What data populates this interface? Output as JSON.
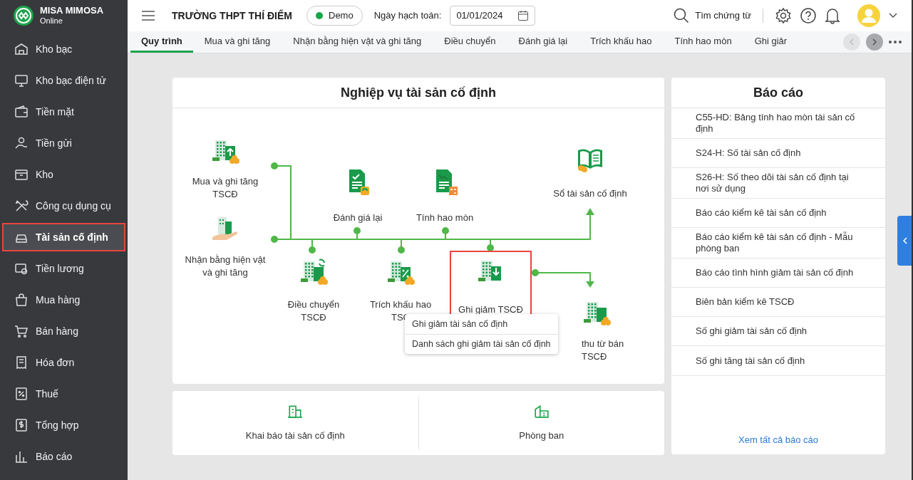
{
  "brand": {
    "name": "MISA MIMOSA",
    "subtitle": "Online"
  },
  "sidebar": {
    "items": [
      {
        "label": "Kho bạc",
        "selected": false
      },
      {
        "label": "Kho bạc điện tử",
        "selected": false
      },
      {
        "label": "Tiền mặt",
        "selected": false
      },
      {
        "label": "Tiền gửi",
        "selected": false
      },
      {
        "label": "Kho",
        "selected": false
      },
      {
        "label": "Công cụ dụng cụ",
        "selected": false
      },
      {
        "label": "Tài sản cố định",
        "selected": true
      },
      {
        "label": "Tiền lương",
        "selected": false
      },
      {
        "label": "Mua hàng",
        "selected": false
      },
      {
        "label": "Bán hàng",
        "selected": false
      },
      {
        "label": "Hóa đơn",
        "selected": false
      },
      {
        "label": "Thuế",
        "selected": false
      },
      {
        "label": "Tổng hợp",
        "selected": false
      },
      {
        "label": "Báo cáo",
        "selected": false
      }
    ]
  },
  "header": {
    "school": "TRƯỜNG THPT THÍ ĐIỂM",
    "mode": "Demo",
    "date_label": "Ngày hạch toán:",
    "date": "01/01/2024",
    "search": "Tìm chứng từ"
  },
  "tabs": [
    {
      "label": "Quy trình",
      "selected": true
    },
    {
      "label": "Mua và ghi tăng",
      "selected": false
    },
    {
      "label": "Nhận bằng hiện vật và ghi tăng",
      "selected": false
    },
    {
      "label": "Điều chuyển",
      "selected": false
    },
    {
      "label": "Đánh giá lại",
      "selected": false
    },
    {
      "label": "Trích khấu hao",
      "selected": false
    },
    {
      "label": "Tính hao mòn",
      "selected": false
    },
    {
      "label": "Ghi giảr",
      "selected": false
    }
  ],
  "workflow": {
    "title": "Nghiệp vụ tài sản cố định",
    "nodes": [
      {
        "lines": [
          "Mua và ghi tăng",
          "TSCĐ"
        ],
        "selected": false
      },
      {
        "lines": [
          "Nhận bằng hiện vật",
          "và ghi tăng"
        ],
        "selected": false
      },
      {
        "lines": [
          "Đánh giá lại"
        ],
        "selected": false
      },
      {
        "lines": [
          "Tính hao mòn"
        ],
        "selected": false
      },
      {
        "lines": [
          "Sổ tài sản cố định"
        ],
        "selected": false
      },
      {
        "lines": [
          "Điều chuyển",
          "TSCĐ"
        ],
        "selected": false
      },
      {
        "lines": [
          "Trích khấu hao",
          "TSC"
        ],
        "selected": false
      },
      {
        "lines": [
          "Ghi giảm TSCĐ"
        ],
        "selected": true
      },
      {
        "lines": [
          "thu từ bán",
          "TSCĐ"
        ],
        "selected": false
      }
    ],
    "menu": [
      "Ghi giảm tài sản cố định",
      "Danh sách ghi giảm tài sản cố định"
    ]
  },
  "shortcuts": [
    "Khai báo tài sản cố định",
    "Phòng ban"
  ],
  "reports": {
    "title": "Báo cáo",
    "items": [
      "C55-HD: Bảng tính hao mòn tài sản cố định",
      "S24-H: Số tài sản cố định",
      "S26-H: Số theo dõi tài sản cố định tại nơi sử dụng",
      "Báo cáo kiểm kê tài sản cố định",
      "Báo cáo kiểm kê tài sản cố định - Mẫu phòng ban",
      "Báo cáo tình hình giảm tài sản cố định",
      "Biên bản kiểm kê TSCĐ",
      "Số ghi giảm tài sản cố định",
      "Số ghi tăng tài sản cố định"
    ],
    "link": "Xem tất cả báo cáo"
  }
}
